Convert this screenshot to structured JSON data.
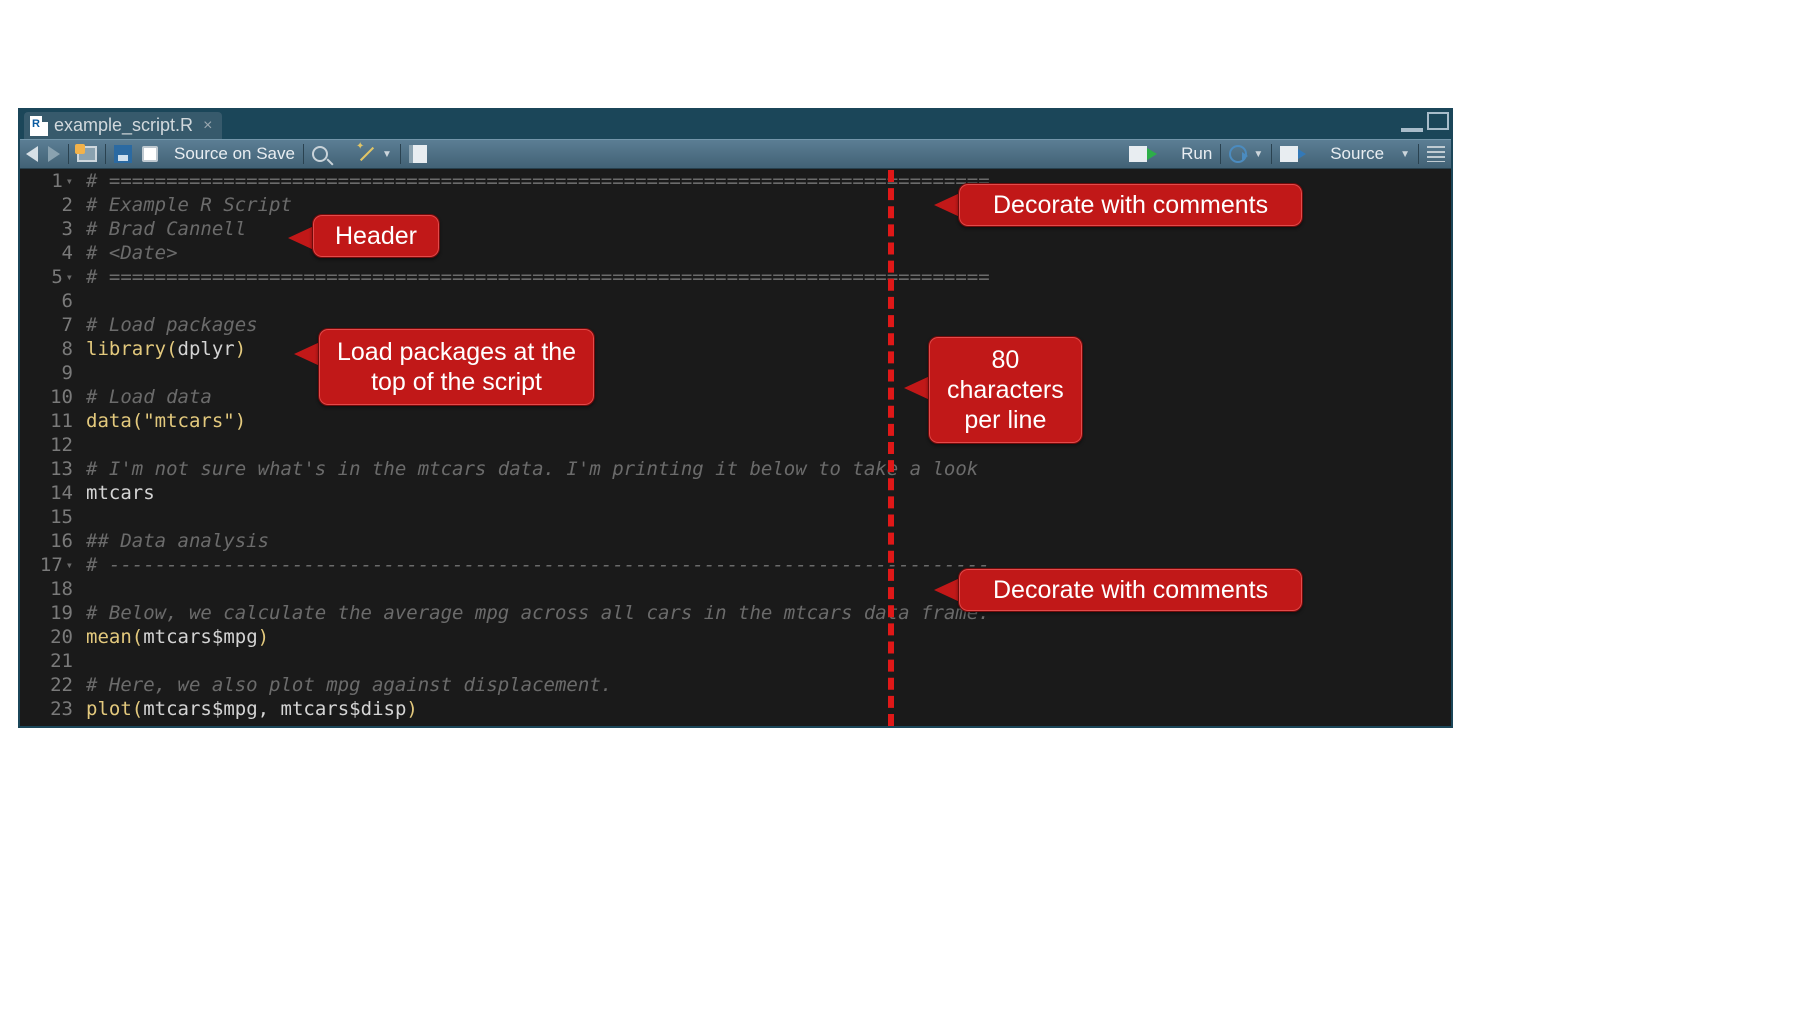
{
  "tab": {
    "title": "example_script.R"
  },
  "toolbar": {
    "source_on_save": "Source on Save",
    "run": "Run",
    "source": "Source"
  },
  "gutter": {
    "lines": [
      1,
      2,
      3,
      4,
      5,
      6,
      7,
      8,
      9,
      10,
      11,
      12,
      13,
      14,
      15,
      16,
      17,
      18,
      19,
      20,
      21,
      22,
      23
    ],
    "folds": [
      1,
      5,
      17
    ]
  },
  "code": {
    "l1": "# =============================================================================",
    "l2": "# Example R Script",
    "l3": "# Brad Cannell",
    "l4": "# <Date>",
    "l5": "# =============================================================================",
    "l6": "",
    "l7": "# Load packages",
    "l8_fn": "library",
    "l8_arg": "dplyr",
    "l9": "",
    "l10": "# Load data",
    "l11_fn": "data",
    "l11_str": "\"mtcars\"",
    "l12": "",
    "l13": "# I'm not sure what's in the mtcars data. I'm printing it below to take a look",
    "l14": "mtcars",
    "l15": "",
    "l16": "## Data analysis",
    "l17": "# -----------------------------------------------------------------------------",
    "l18": "",
    "l19": "# Below, we calculate the average mpg across all cars in the mtcars data frame.",
    "l20_fn": "mean",
    "l20_a": "mtcars",
    "l20_b": "mpg",
    "l21": "",
    "l22": "# Here, we also plot mpg against displacement.",
    "l23_fn": "plot",
    "l23_a": "mtcars",
    "l23_b": "mpg",
    "l23_c": "mtcars",
    "l23_d": "disp"
  },
  "annotations": {
    "header": "Header",
    "load_pkgs_l1": "Load packages at the",
    "load_pkgs_l2": "top of the script",
    "decorate": "Decorate with comments",
    "eighty_l1": "80",
    "eighty_l2": "characters",
    "eighty_l3": "per line"
  }
}
